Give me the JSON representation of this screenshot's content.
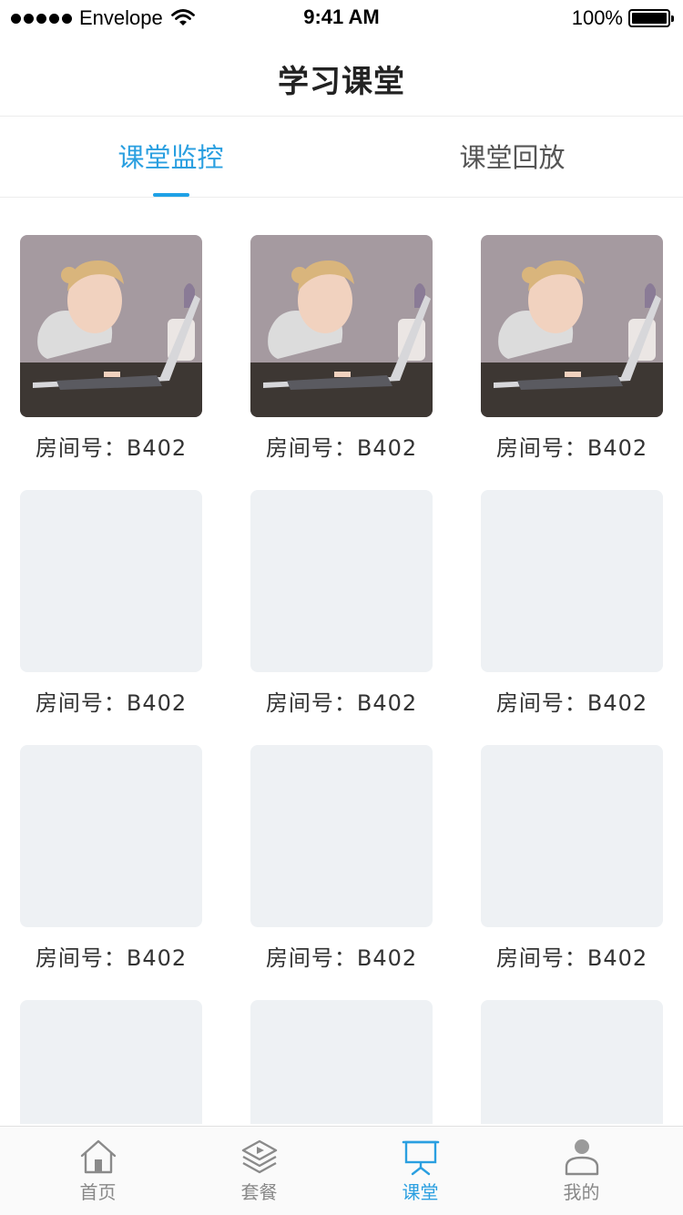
{
  "status_bar": {
    "carrier": "Envelope",
    "time": "9:41 AM",
    "battery": "100%"
  },
  "header": {
    "title": "学习课堂"
  },
  "tabs": [
    {
      "label": "课堂监控",
      "active": true
    },
    {
      "label": "课堂回放",
      "active": false
    }
  ],
  "rooms": [
    {
      "label": "房间号：B402",
      "has_image": true
    },
    {
      "label": "房间号：B402",
      "has_image": true
    },
    {
      "label": "房间号：B402",
      "has_image": true
    },
    {
      "label": "房间号：B402",
      "has_image": false
    },
    {
      "label": "房间号：B402",
      "has_image": false
    },
    {
      "label": "房间号：B402",
      "has_image": false
    },
    {
      "label": "房间号：B402",
      "has_image": false
    },
    {
      "label": "房间号：B402",
      "has_image": false
    },
    {
      "label": "房间号：B402",
      "has_image": false
    },
    {
      "label": "",
      "has_image": false
    },
    {
      "label": "",
      "has_image": false
    },
    {
      "label": "",
      "has_image": false
    }
  ],
  "tab_bar": [
    {
      "label": "首页",
      "icon": "home-icon",
      "active": false
    },
    {
      "label": "套餐",
      "icon": "layers-icon",
      "active": false
    },
    {
      "label": "课堂",
      "icon": "presentation-board-icon",
      "active": true
    },
    {
      "label": "我的",
      "icon": "user-icon",
      "active": false
    }
  ],
  "colors": {
    "accent": "#2a9fe0",
    "placeholder": "#eef1f4",
    "inactive": "#888888"
  }
}
